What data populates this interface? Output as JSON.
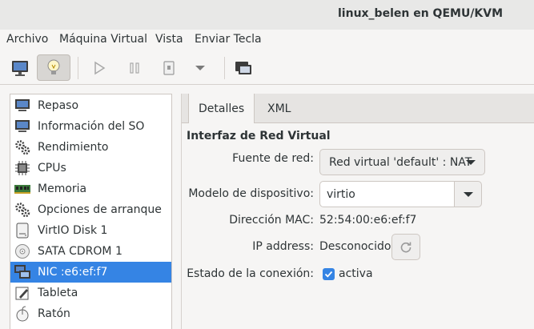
{
  "window": {
    "title": "linux_belen en QEMU/KVM"
  },
  "menu": [
    "Archivo",
    "Máquina Virtual",
    "Vista",
    "Enviar Tecla"
  ],
  "toolbar": {
    "buttons": [
      "monitor-icon",
      "lightbulb-icon",
      "play-icon",
      "pause-icon",
      "power-icon",
      "dropdown-arrow-icon",
      "screenshot-icon"
    ],
    "active": "lightbulb-icon"
  },
  "sidebar": {
    "items": [
      {
        "label": "Repaso",
        "icon": "monitor-icon"
      },
      {
        "label": "Información del SO",
        "icon": "monitor-icon"
      },
      {
        "label": "Rendimiento",
        "icon": "gears-icon"
      },
      {
        "label": "CPUs",
        "icon": "cpu-chip-icon"
      },
      {
        "label": "Memoria",
        "icon": "memory-icon"
      },
      {
        "label": "Opciones de arranque",
        "icon": "gears-icon"
      },
      {
        "label": "VirtIO Disk 1",
        "icon": "disk-icon"
      },
      {
        "label": "SATA CDROM 1",
        "icon": "cdrom-icon"
      },
      {
        "label": "NIC :e6:ef:f7",
        "icon": "network-icon",
        "selected": true
      },
      {
        "label": "Tableta",
        "icon": "tablet-icon"
      },
      {
        "label": "Ratón",
        "icon": "mouse-icon"
      }
    ]
  },
  "tabs": [
    {
      "label": "Detalles",
      "active": true
    },
    {
      "label": "XML",
      "active": false
    }
  ],
  "details": {
    "section_title": "Interfaz de Red Virtual",
    "network_source_label": "Fuente de red:",
    "network_source_value": "Red virtual 'default' : NAT",
    "device_model_label": "Modelo de dispositivo:",
    "device_model_value": "virtio",
    "mac_label": "Dirección MAC:",
    "mac_value": "52:54:00:e6:ef:f7",
    "ip_label": "IP address:",
    "ip_value": "Desconocido",
    "link_state_label": "Estado de la conexión:",
    "link_state_value": "activa",
    "link_state_checked": true
  },
  "colors": {
    "accent": "#3584e4",
    "titlebar": "#e8e8e7",
    "background": "#f6f5f4"
  }
}
